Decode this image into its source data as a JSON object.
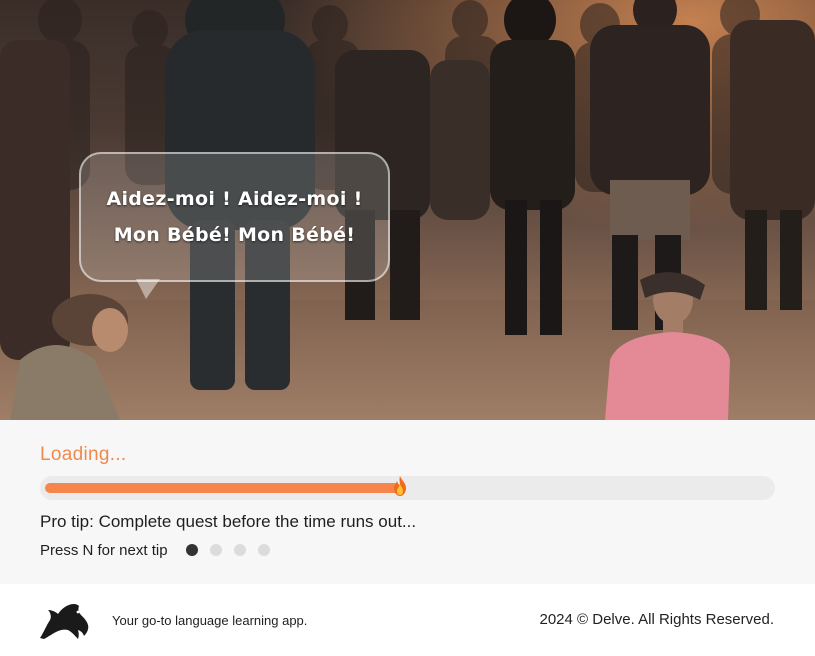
{
  "scene": {
    "speech_line_1": "Aidez-moi ! Aidez-moi !",
    "speech_line_2": "Mon Bébé!  Mon Bébé!"
  },
  "loading": {
    "label": "Loading...",
    "progress": 0.49,
    "pro_tip": "Pro tip: Complete quest before the time runs out...",
    "next_tip_hint": "Press N for next tip",
    "tip_count": 4,
    "active_tip_index": 0,
    "accent_color": "#f5854a",
    "flame_icon": "fire-icon"
  },
  "footer": {
    "logo_icon": "dolphin-logo-icon",
    "tagline": "Your go-to language learning app.",
    "copyright": "2024 © Delve. All Rights Reserved."
  }
}
